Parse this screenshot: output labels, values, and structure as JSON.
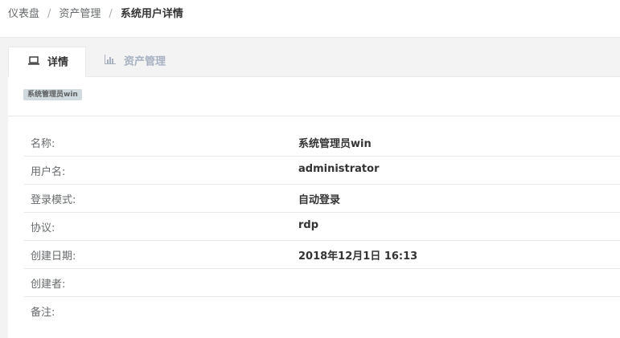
{
  "breadcrumb": {
    "items": [
      {
        "label": "仪表盘"
      },
      {
        "label": "资产管理"
      },
      {
        "label": "系统用户详情"
      }
    ],
    "separator": "/"
  },
  "tabs": [
    {
      "label": "详情",
      "icon": "laptop-icon",
      "active": true
    },
    {
      "label": "资产管理",
      "icon": "bar-chart-icon",
      "active": false
    }
  ],
  "badge": {
    "label": "系统管理员win"
  },
  "details": {
    "rows": [
      {
        "label": "名称:",
        "value": "系统管理员win"
      },
      {
        "label": "用户名:",
        "value": "administrator"
      },
      {
        "label": "登录模式:",
        "value": "自动登录"
      },
      {
        "label": "协议:",
        "value": "rdp"
      },
      {
        "label": "创建日期:",
        "value": "2018年12月1日 16:13"
      },
      {
        "label": "创建者:",
        "value": ""
      },
      {
        "label": "备注:",
        "value": ""
      }
    ]
  },
  "colors": {
    "page_bg": "#f3f3f4",
    "text": "#676a6c",
    "text_strong": "#333333",
    "inactive_tab": "#a7b1c2",
    "badge_bg": "#d1dade",
    "border": "#e7eaec"
  }
}
